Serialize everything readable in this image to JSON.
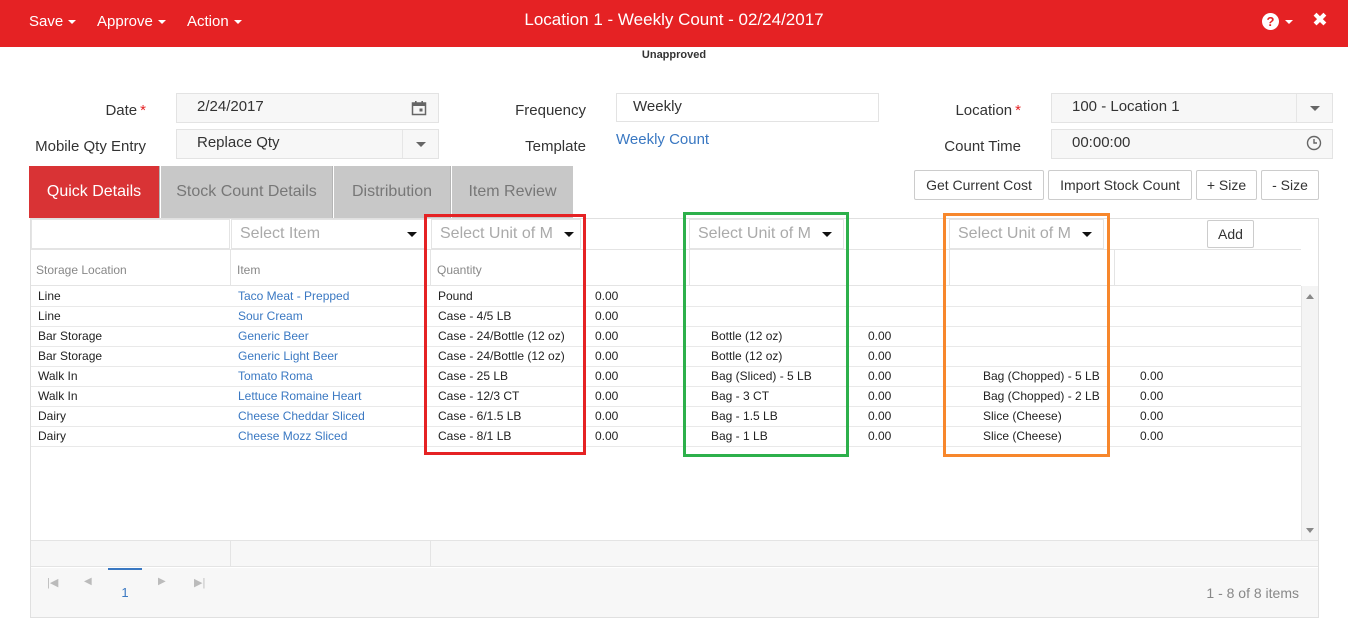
{
  "topbar": {
    "title": "Location 1 - Weekly Count - 02/24/2017",
    "menus": [
      {
        "label": "Save"
      },
      {
        "label": "Approve"
      },
      {
        "label": "Action"
      }
    ],
    "help_icon": "?",
    "close_icon": "✖"
  },
  "status": "Unapproved",
  "form": {
    "date_label": "Date",
    "date_value": "2/24/2017",
    "mobile_label": "Mobile Qty Entry",
    "mobile_value": "Replace Qty",
    "frequency_label": "Frequency",
    "frequency_value": "Weekly",
    "template_label": "Template",
    "template_value": "Weekly Count",
    "location_label": "Location",
    "location_value": "100 - Location 1",
    "count_time_label": "Count Time",
    "count_time_value": "00:00:00",
    "required_mark": "*"
  },
  "tabs": [
    {
      "label": "Quick Details",
      "active": true
    },
    {
      "label": "Stock Count Details"
    },
    {
      "label": "Distribution"
    },
    {
      "label": "Item Review"
    }
  ],
  "buttons": {
    "get_current_cost": "Get Current Cost",
    "import_stock_count": "Import Stock Count",
    "plus_size": "+ Size",
    "minus_size": "- Size",
    "add": "Add"
  },
  "filters": {
    "item_placeholder": "Select Item",
    "uom_placeholder": "Select Unit of M"
  },
  "columns": {
    "storage_location": "Storage Location",
    "item": "Item",
    "quantity": "Quantity"
  },
  "rows": [
    {
      "loc": "Line",
      "item": "Taco Meat - Prepped",
      "u1": "Pound",
      "q1": "0.00",
      "u2": "",
      "q2": "",
      "u3": "",
      "q3": ""
    },
    {
      "loc": "Line",
      "item": "Sour Cream",
      "u1": "Case - 4/5 LB",
      "q1": "0.00",
      "u2": "",
      "q2": "",
      "u3": "",
      "q3": ""
    },
    {
      "loc": "Bar Storage",
      "item": "Generic Beer",
      "u1": "Case - 24/Bottle (12 oz)",
      "q1": "0.00",
      "u2": "Bottle (12 oz)",
      "q2": "0.00",
      "u3": "",
      "q3": ""
    },
    {
      "loc": "Bar Storage",
      "item": "Generic Light Beer",
      "u1": "Case - 24/Bottle (12 oz)",
      "q1": "0.00",
      "u2": "Bottle (12 oz)",
      "q2": "0.00",
      "u3": "",
      "q3": ""
    },
    {
      "loc": "Walk In",
      "item": "Tomato Roma",
      "u1": "Case - 25 LB",
      "q1": "0.00",
      "u2": "Bag (Sliced) - 5 LB",
      "q2": "0.00",
      "u3": "Bag (Chopped) - 5 LB",
      "q3": "0.00"
    },
    {
      "loc": "Walk In",
      "item": "Lettuce Romaine Heart",
      "u1": "Case - 12/3 CT",
      "q1": "0.00",
      "u2": "Bag - 3 CT",
      "q2": "0.00",
      "u3": "Bag (Chopped) - 2 LB",
      "q3": "0.00"
    },
    {
      "loc": "Dairy",
      "item": "Cheese Cheddar Sliced",
      "u1": "Case - 6/1.5 LB",
      "q1": "0.00",
      "u2": "Bag - 1.5 LB",
      "q2": "0.00",
      "u3": "Slice (Cheese)",
      "q3": "0.00"
    },
    {
      "loc": "Dairy",
      "item": "Cheese Mozz Sliced",
      "u1": "Case - 8/1 LB",
      "q1": "0.00",
      "u2": "Bag - 1 LB",
      "q2": "0.00",
      "u3": "Slice (Cheese)",
      "q3": "0.00"
    }
  ],
  "pager": {
    "page": "1",
    "info": "1 - 8 of 8 items",
    "first_icon": "|◀",
    "prev_icon": "◀",
    "next_icon": "▶",
    "last_icon": "▶|"
  },
  "highlight_colors": {
    "red": "#e52224",
    "green": "#2db04b",
    "orange": "#f7872c"
  }
}
